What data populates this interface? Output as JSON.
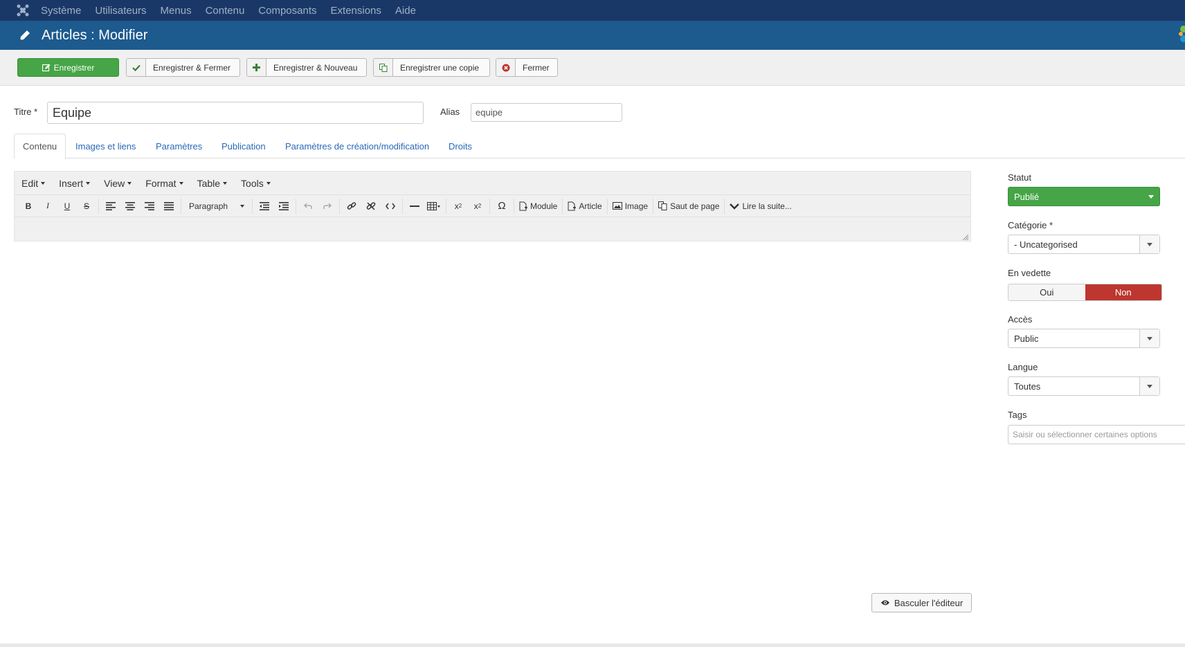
{
  "topnav": {
    "items": [
      "Système",
      "Utilisateurs",
      "Menus",
      "Contenu",
      "Composants",
      "Extensions",
      "Aide"
    ]
  },
  "header": {
    "title": "Articles : Modifier"
  },
  "toolbar": {
    "save": "Enregistrer",
    "save_close": "Enregistrer & Fermer",
    "save_new": "Enregistrer & Nouveau",
    "save_copy": "Enregistrer une copie",
    "close": "Fermer"
  },
  "form": {
    "title_label": "Titre *",
    "title_value": "Equipe",
    "alias_label": "Alias",
    "alias_value": "equipe"
  },
  "tabs": [
    "Contenu",
    "Images et liens",
    "Paramètres",
    "Publication",
    "Paramètres de création/modification",
    "Droits"
  ],
  "editor": {
    "menus": [
      "Edit",
      "Insert",
      "View",
      "Format",
      "Table",
      "Tools"
    ],
    "format_select": "Paragraph",
    "buttons": {
      "module": "Module",
      "article": "Article",
      "image": "Image",
      "pagebreak": "Saut de page",
      "readmore": "Lire la suite..."
    },
    "toggle_editor": "Basculer l'éditeur"
  },
  "sidebar": {
    "status_label": "Statut",
    "status_value": "Publié",
    "category_label": "Catégorie *",
    "category_value": "- Uncategorised",
    "featured_label": "En vedette",
    "featured_yes": "Oui",
    "featured_no": "Non",
    "access_label": "Accès",
    "access_value": "Public",
    "language_label": "Langue",
    "language_value": "Toutes",
    "tags_label": "Tags",
    "tags_placeholder": "Saisir ou sélectionner certaines options"
  },
  "colors": {
    "topnav_bg": "#1a3867",
    "titlebar_bg": "#1d5a8e",
    "success": "#46a546",
    "danger": "#bd362f",
    "link": "#2a69b8"
  }
}
